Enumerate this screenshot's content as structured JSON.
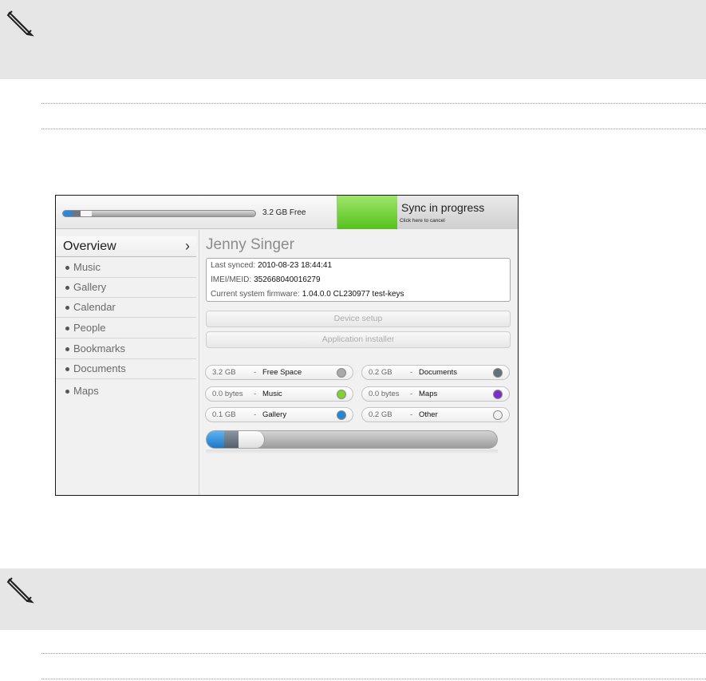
{
  "notes": {
    "top_icon": "pencil-note-icon",
    "bottom_icon": "pencil-note-icon"
  },
  "sync_window": {
    "storage_bar": {
      "free_label": "3.2  GB Free",
      "segments": [
        {
          "color": "#2f86d6",
          "fraction": 0.05
        },
        {
          "color": "#6c7680",
          "fraction": 0.04
        },
        {
          "color": "#f6f6f6",
          "fraction": 0.06
        }
      ]
    },
    "sync_button": {
      "title": "Sync in progress",
      "subtitle": "Click here to cancel",
      "progress": 0.33,
      "progress_color": "#55c21d"
    },
    "sidebar": {
      "overview_label": "Overview",
      "overview_icon": "chevron-right-icon",
      "items": [
        {
          "label": "Music"
        },
        {
          "label": "Gallery"
        },
        {
          "label": "Calendar"
        },
        {
          "label": "People"
        },
        {
          "label": "Bookmarks"
        },
        {
          "label": "Documents"
        },
        {
          "label": "Maps"
        }
      ]
    },
    "device": {
      "user_name": "Jenny Singer",
      "last_synced_label": "Last synced:",
      "last_synced_value": "2010-08-23 18:44:41",
      "imei_label": "IMEI/MEID:",
      "imei_value": "352668040016279",
      "firmware_label": "Current system firmware:",
      "firmware_value": "1.04.0.0 CL230977 test-keys"
    },
    "buttons": {
      "device_setup": "Device setup",
      "app_installer": "Application installer"
    },
    "categories": [
      {
        "size": "3.2 GB",
        "name": "Free Space",
        "color": "#a9a9a9"
      },
      {
        "size": "0.2 GB",
        "name": "Documents",
        "color": "#626f7c"
      },
      {
        "size": "0.0 bytes",
        "name": "Music",
        "color": "#82d12c"
      },
      {
        "size": "0.0 bytes",
        "name": "Maps",
        "color": "#7b2fc9"
      },
      {
        "size": "0.1 GB",
        "name": "Gallery",
        "color": "#2487d6"
      },
      {
        "size": "0.2 GB",
        "name": "Other",
        "color": "#f2f2f2"
      }
    ],
    "usage_bar": {
      "segments": [
        {
          "color": "#2a86d4",
          "fraction": 0.06
        },
        {
          "color": "#6d7985",
          "fraction": 0.05
        },
        {
          "color": "#ffffff",
          "fraction": 0.09
        }
      ]
    }
  }
}
